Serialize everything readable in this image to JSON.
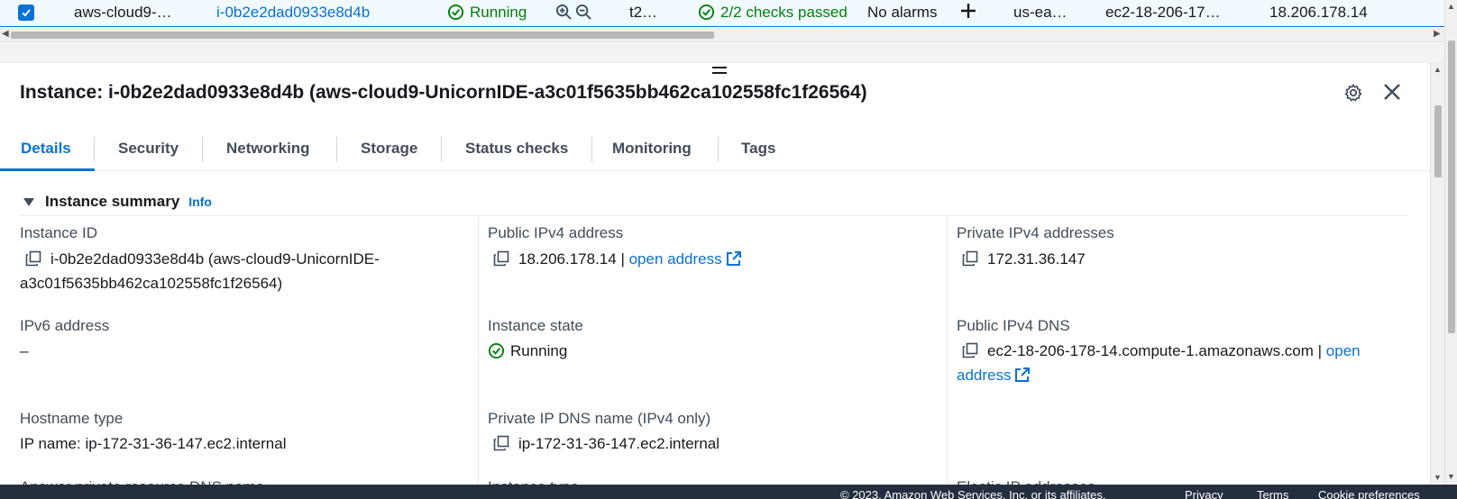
{
  "table_row": {
    "name": "aws-cloud9-…",
    "instance_id": "i-0b2e2dad0933e8d4b",
    "state": "Running",
    "type": "t2…",
    "status_check": "2/2 checks passed",
    "alarm_status": "No alarms",
    "az": "us-ea…",
    "public_dns": "ec2-18-206-17…",
    "public_ip": "18.206.178.14"
  },
  "panel": {
    "title": "Instance: i-0b2e2dad0933e8d4b (aws-cloud9-UnicornIDE-a3c01f5635bb462ca102558fc1f26564)"
  },
  "tabs": [
    {
      "label": "Details"
    },
    {
      "label": "Security"
    },
    {
      "label": "Networking"
    },
    {
      "label": "Storage"
    },
    {
      "label": "Status checks"
    },
    {
      "label": "Monitoring"
    },
    {
      "label": "Tags"
    }
  ],
  "summary": {
    "heading": "Instance summary",
    "info": "Info",
    "instance_id_label": "Instance ID",
    "instance_id_value_line1": "i-0b2e2dad0933e8d4b (aws-cloud9-UnicornIDE-",
    "instance_id_value_line2": "a3c01f5635bb462ca102558fc1f26564)",
    "public_ipv4_label": "Public IPv4 address",
    "public_ipv4_value": "18.206.178.14 |",
    "open_address": "open address",
    "private_ipv4_label": "Private IPv4 addresses",
    "private_ipv4_value": "172.31.36.147",
    "ipv6_label": "IPv6 address",
    "ipv6_value": "–",
    "state_label": "Instance state",
    "state_value": "Running",
    "public_dns_label": "Public IPv4 DNS",
    "public_dns_value": "ec2-18-206-178-14.compute-1.amazonaws.com |",
    "public_dns_open_1": "open",
    "public_dns_open_2": "address",
    "hostname_type_label": "Hostname type",
    "hostname_type_value": "IP name: ip-172-31-36-147.ec2.internal",
    "private_dns_label": "Private IP DNS name (IPv4 only)",
    "private_dns_value": "ip-172-31-36-147.ec2.internal",
    "answer_dns_label": "Answer private resource DNS name",
    "instance_type_label": "Instance type",
    "elastic_ip_label": "Elastic IP addresses"
  },
  "footer": {
    "copyright": "© 2023, Amazon Web Services, Inc. or its affiliates.",
    "privacy": "Privacy",
    "terms": "Terms",
    "cookie": "Cookie preferences"
  },
  "colors": {
    "link": "#0972d3",
    "success": "#037f0c",
    "footer_bg": "#232f3e"
  }
}
